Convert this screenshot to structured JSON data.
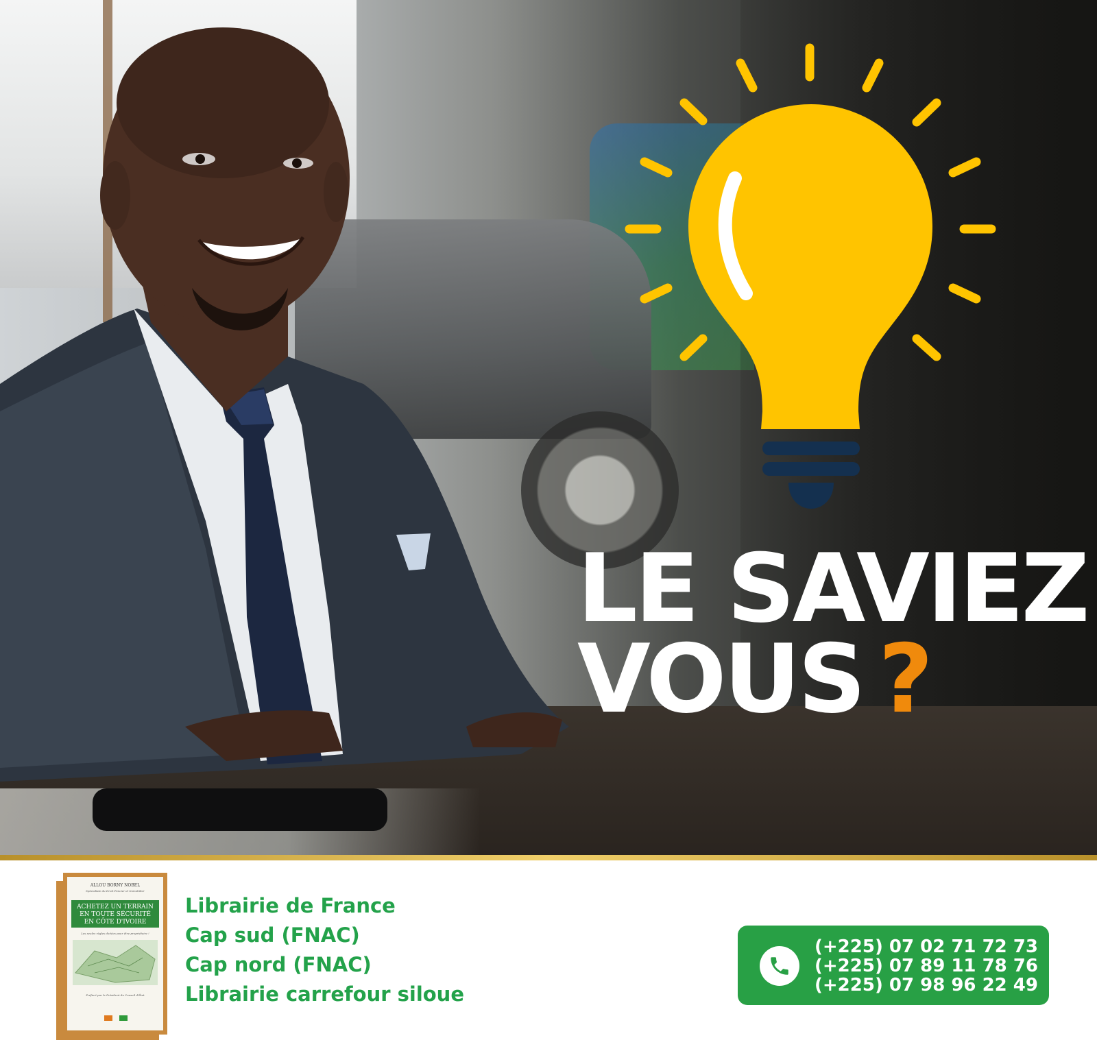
{
  "headline": {
    "line1": "LE SAVIEZ",
    "line2": "VOUS",
    "question_mark": "?"
  },
  "book": {
    "author": "ALLOU BORNY NOBEL",
    "author_subtitle": "Spécialiste du Droit Foncier et Immobilier",
    "title_lines": [
      "ACHETEZ UN TERRAIN",
      "EN TOUTE SÉCURITÉ",
      "EN CÔTE D'IVOIRE"
    ],
    "tagline": "Les seules règles dictées pour être propriétaire !",
    "preface": "Préfacé par le Président du Conseil d'État"
  },
  "stores": [
    "Librairie de France",
    "Cap sud (FNAC)",
    "Cap nord (FNAC)",
    "Librairie carrefour siloue"
  ],
  "contact": {
    "icon": "phone-icon",
    "numbers": [
      "(+225) 07 02 71 72 73",
      "(+225) 07 89 11 78 76",
      "(+225) 07 98 96 22 49"
    ]
  },
  "colors": {
    "accent_orange": "#f08a0c",
    "bulb_yellow": "#ffc400",
    "bulb_base_navy": "#14304f",
    "green": "#28a045",
    "gold": "#d9b04a"
  }
}
